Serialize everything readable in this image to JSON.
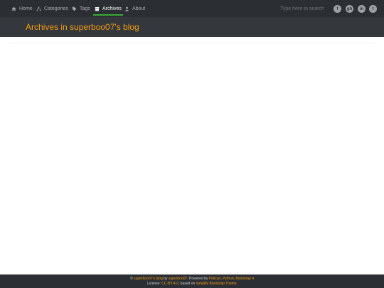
{
  "nav": {
    "items": [
      {
        "label": "Home",
        "icon": "home-icon"
      },
      {
        "label": "Categories",
        "icon": "sitemap-icon"
      },
      {
        "label": "Tags",
        "icon": "tag-icon"
      },
      {
        "label": "Archives",
        "icon": "archive-icon",
        "active": true
      },
      {
        "label": "About",
        "icon": "user-icon"
      }
    ],
    "search_placeholder": "Type here to search",
    "social": [
      {
        "name": "facebook-icon",
        "glyph": "f"
      },
      {
        "name": "github-icon",
        "glyph": "gh"
      },
      {
        "name": "linkedin-icon",
        "glyph": "in"
      },
      {
        "name": "twitter-icon",
        "glyph": "t"
      }
    ]
  },
  "header": {
    "title": "Archives in superboo07's blog"
  },
  "footer": {
    "copyright": "©",
    "blog_link": "superboo07's blog",
    "by": "by",
    "author_link": "superboo07",
    "powered_by": ". Powered by",
    "pelican_link": "Pelican",
    "sep1": ",",
    "python_link": "Python",
    "sep2": ",",
    "bootstrap_link": "Bootstrap 4",
    "license_label": "License:",
    "license_link": "CC-BY-4.0",
    "based_on": ", based on",
    "theme_link": "Simplify Bootstrap Theme"
  },
  "colors": {
    "navbar": "#2b2e33",
    "header": "#34373c",
    "accent": "#f39c12",
    "active_underline": "#3aa836"
  }
}
